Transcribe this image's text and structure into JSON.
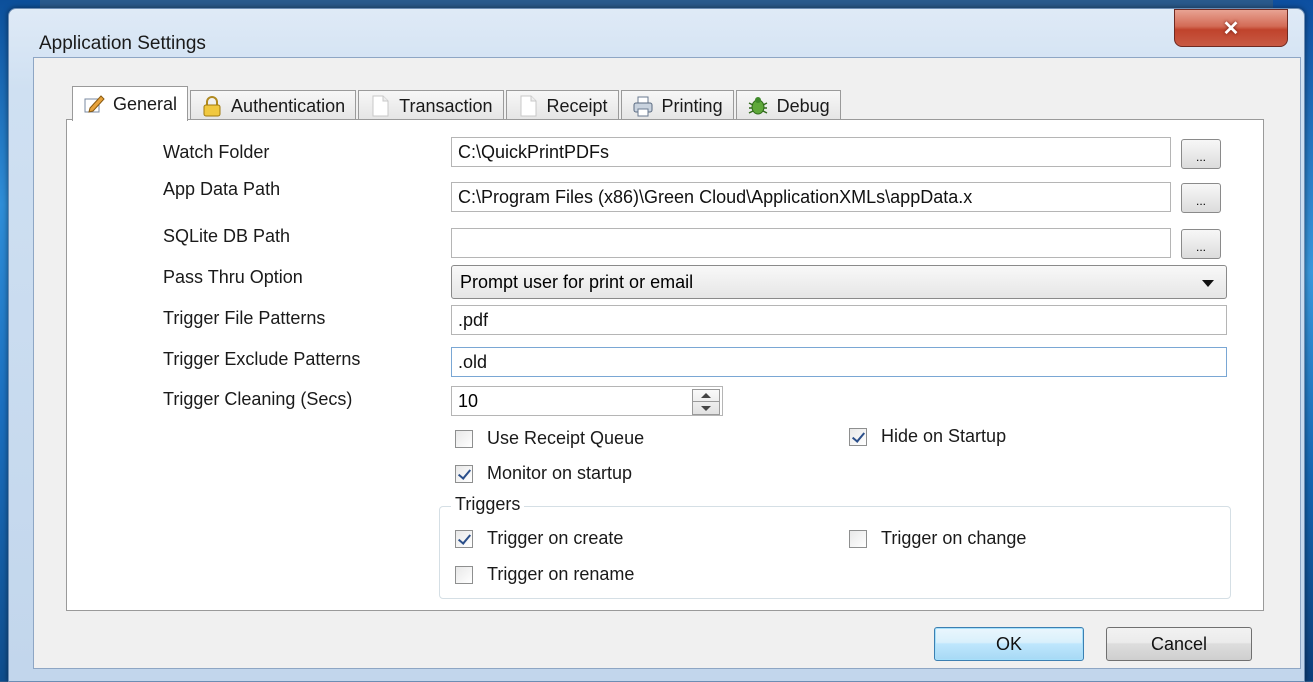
{
  "window": {
    "title": "Application Settings",
    "close_glyph": "✕"
  },
  "tabs": [
    {
      "label": "General",
      "icon": "edit-pencil-icon",
      "active": true
    },
    {
      "label": "Authentication",
      "icon": "lock-icon"
    },
    {
      "label": "Transaction",
      "icon": "document-icon"
    },
    {
      "label": "Receipt",
      "icon": "document-icon"
    },
    {
      "label": "Printing",
      "icon": "printer-icon"
    },
    {
      "label": "Debug",
      "icon": "bug-icon"
    }
  ],
  "fields": {
    "watch_folder": {
      "label": "Watch Folder",
      "value": "C:\\QuickPrintPDFs",
      "browse": "..."
    },
    "app_data_path": {
      "label": "App Data Path",
      "value": "C:\\Program Files (x86)\\Green Cloud\\ApplicationXMLs\\appData.x",
      "browse": "..."
    },
    "sqlite_db_path": {
      "label": "SQLite DB Path",
      "value": "",
      "browse": "..."
    },
    "pass_thru_option": {
      "label": "Pass Thru Option",
      "value": "Prompt user for print or email"
    },
    "trigger_file_patterns": {
      "label": "Trigger File Patterns",
      "value": ".pdf"
    },
    "trigger_exclude_patterns": {
      "label": "Trigger Exclude Patterns",
      "value": ".old"
    },
    "trigger_cleaning": {
      "label": "Trigger Cleaning (Secs)",
      "value": "10"
    }
  },
  "options": {
    "use_receipt_queue": {
      "label": "Use Receipt Queue",
      "checked": false
    },
    "hide_on_startup": {
      "label": "Hide on Startup",
      "checked": true
    },
    "monitor_on_startup": {
      "label": "Monitor on startup",
      "checked": true
    }
  },
  "triggers": {
    "title": "Triggers",
    "on_create": {
      "label": "Trigger on create",
      "checked": true
    },
    "on_change": {
      "label": "Trigger on change",
      "checked": false
    },
    "on_rename": {
      "label": "Trigger on rename",
      "checked": false
    }
  },
  "buttons": {
    "ok": "OK",
    "cancel": "Cancel"
  },
  "colors": {
    "close_red": "#c0432c",
    "accent_blue": "#3c7fb1",
    "check_mark": "#2b4f8a"
  }
}
